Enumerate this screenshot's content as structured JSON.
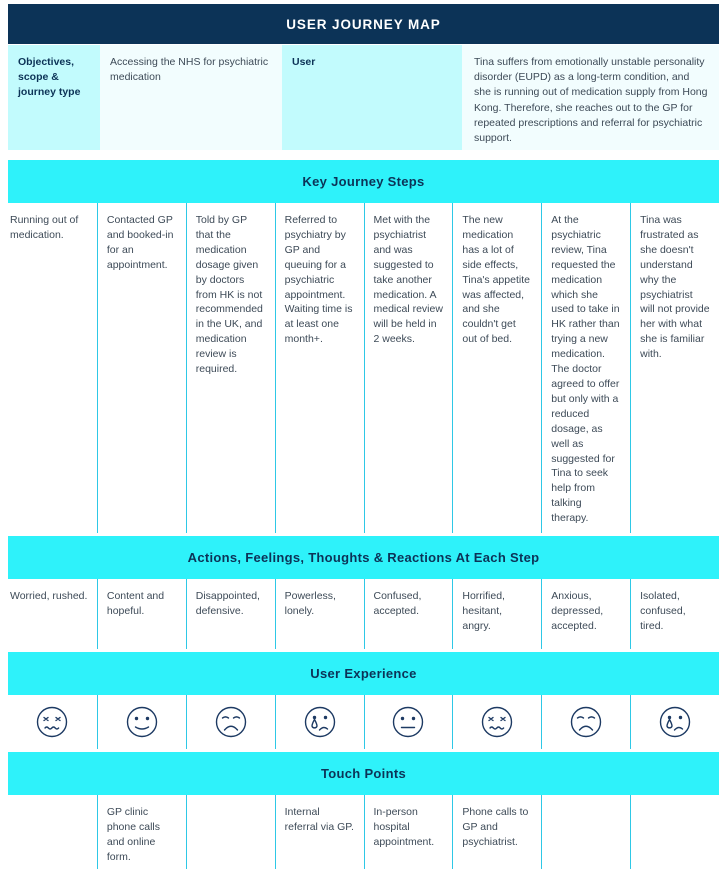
{
  "title": "USER JOURNEY MAP",
  "colors": {
    "navy": "#0c3357",
    "cyan_bright": "#2ef2fa",
    "cyan_light": "#c2fbfd",
    "cyan_pale": "#f2fdfe",
    "divider": "#2ec8e6",
    "body_text": "#3d4a57"
  },
  "meta": {
    "objectives_label": "Objectives, scope & journey type",
    "objectives_value": "Accessing the NHS for psychiatric medication",
    "user_label": "User",
    "user_value": "Tina suffers from emotionally unstable personality disorder (EUPD) as a long-term condition, and she is running out of medication supply from Hong Kong. Therefore, she reaches out to the GP for repeated prescriptions and referral for psychiatric support."
  },
  "sections": {
    "steps_title": "Key Journey Steps",
    "actions_title": "Actions, Feelings, Thoughts & Reactions At Each Step",
    "ux_title": "User Experience",
    "touch_title": "Touch Points"
  },
  "steps": [
    "Running out of medication.",
    "Contacted GP and booked-in for an appointment.",
    "Told by GP that the medication dosage given by doctors from HK is not recommended in the UK, and medication review is required.",
    "Referred to psychiatry by GP and queuing for a psychiatric appointment. Waiting time is at least one month+.",
    "Met with the psychiatrist and was suggested to take another medication. A medical review will be held in 2 weeks.",
    "The new medication has a lot of side effects, Tina's appetite was affected, and she couldn't get out of bed.",
    "At the psychiatric review, Tina requested the medication which she used to take in HK rather than trying a new medication. The doctor agreed to offer but only with a reduced dosage, as well as suggested for Tina to seek help from talking therapy.",
    "Tina was frustrated as she doesn't understand why the psychiatrist will not provide her with what she is familiar with."
  ],
  "actions": [
    "Worried, rushed.",
    "Content and hopeful.",
    "Disappointed, defensive.",
    "Powerless, lonely.",
    "Confused, accepted.",
    "Horrified, hesitant, angry.",
    "Anxious, depressed, accepted.",
    "Isolated, confused, tired."
  ],
  "user_experience": [
    {
      "icon": "confounded-face-icon",
      "mood": "confounded"
    },
    {
      "icon": "slightly-smiling-face-icon",
      "mood": "slightly-smiling"
    },
    {
      "icon": "frowning-face-icon",
      "mood": "frowning"
    },
    {
      "icon": "crying-face-icon",
      "mood": "crying"
    },
    {
      "icon": "neutral-face-icon",
      "mood": "neutral"
    },
    {
      "icon": "confounded-face-icon",
      "mood": "confounded"
    },
    {
      "icon": "frowning-face-icon",
      "mood": "frowning"
    },
    {
      "icon": "crying-face-icon",
      "mood": "crying"
    }
  ],
  "touch_points": [
    "",
    "GP clinic phone calls and online form.",
    "",
    "Internal referral via GP.",
    "In-person hospital appointment.",
    "Phone calls to GP and psychiatrist.",
    "",
    ""
  ]
}
